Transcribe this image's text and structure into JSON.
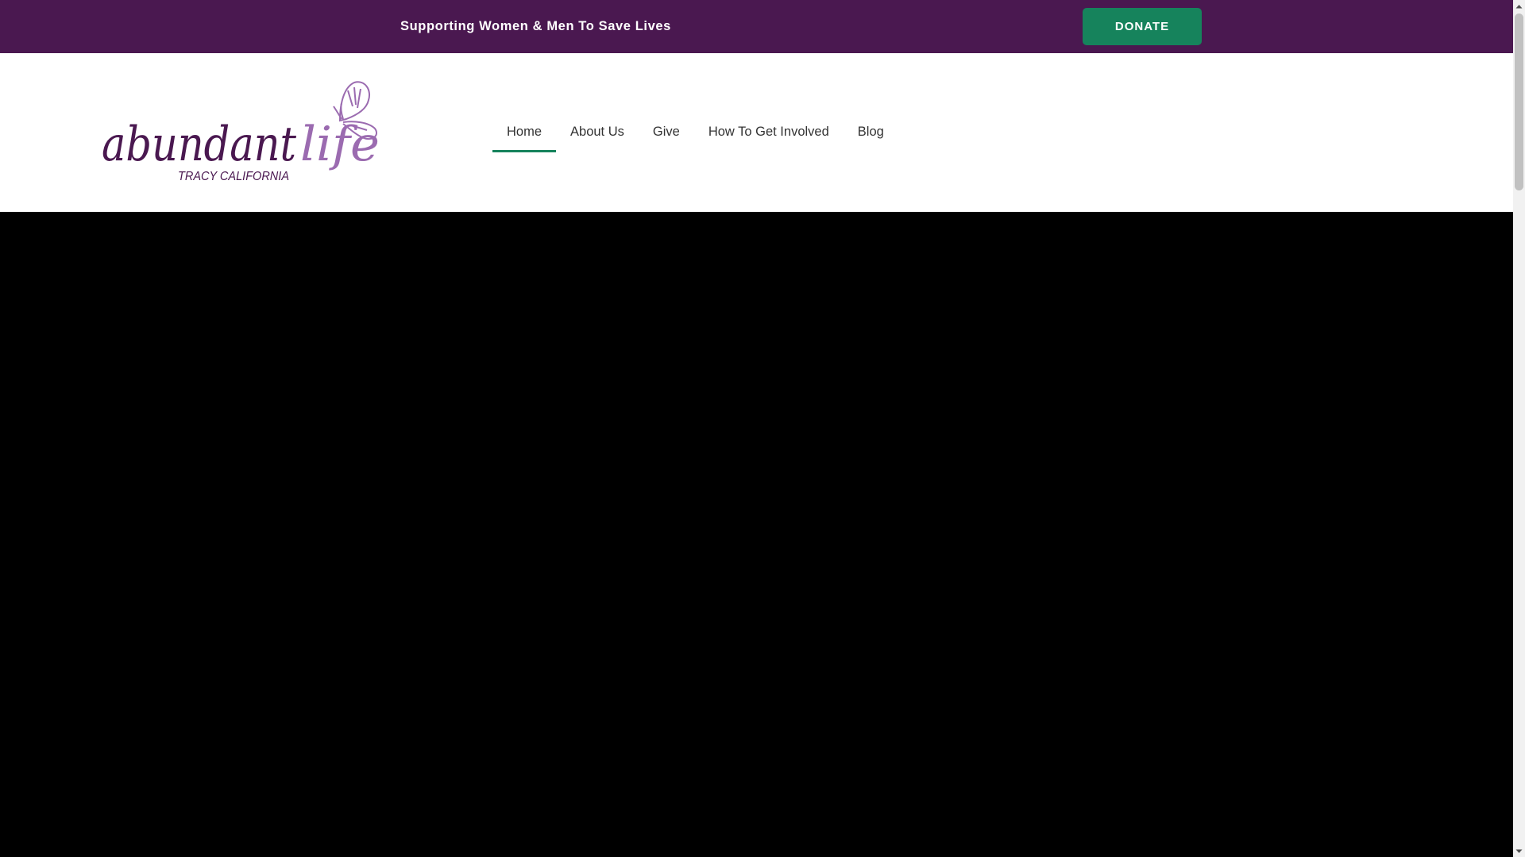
{
  "topbar": {
    "tagline": "Supporting Women & Men To Save Lives",
    "donate_label": "DONATE"
  },
  "logo": {
    "word_main": "abundant",
    "word_accent": "life",
    "subtitle": "TRACY CALIFORNIA",
    "icon": "butterfly-icon"
  },
  "nav": {
    "items": [
      {
        "label": "Home",
        "active": true
      },
      {
        "label": "About Us"
      },
      {
        "label": "Give"
      },
      {
        "label": "How To Get Involved"
      },
      {
        "label": "Blog"
      }
    ]
  },
  "colors": {
    "brand_purple": "#4a1850",
    "accent_purple": "#9b6bb0",
    "donate_green": "#16835c",
    "hero_background": "#000000"
  },
  "icons": {
    "scroll_up": "chevron-up-icon",
    "scroll_down": "chevron-down-icon"
  }
}
